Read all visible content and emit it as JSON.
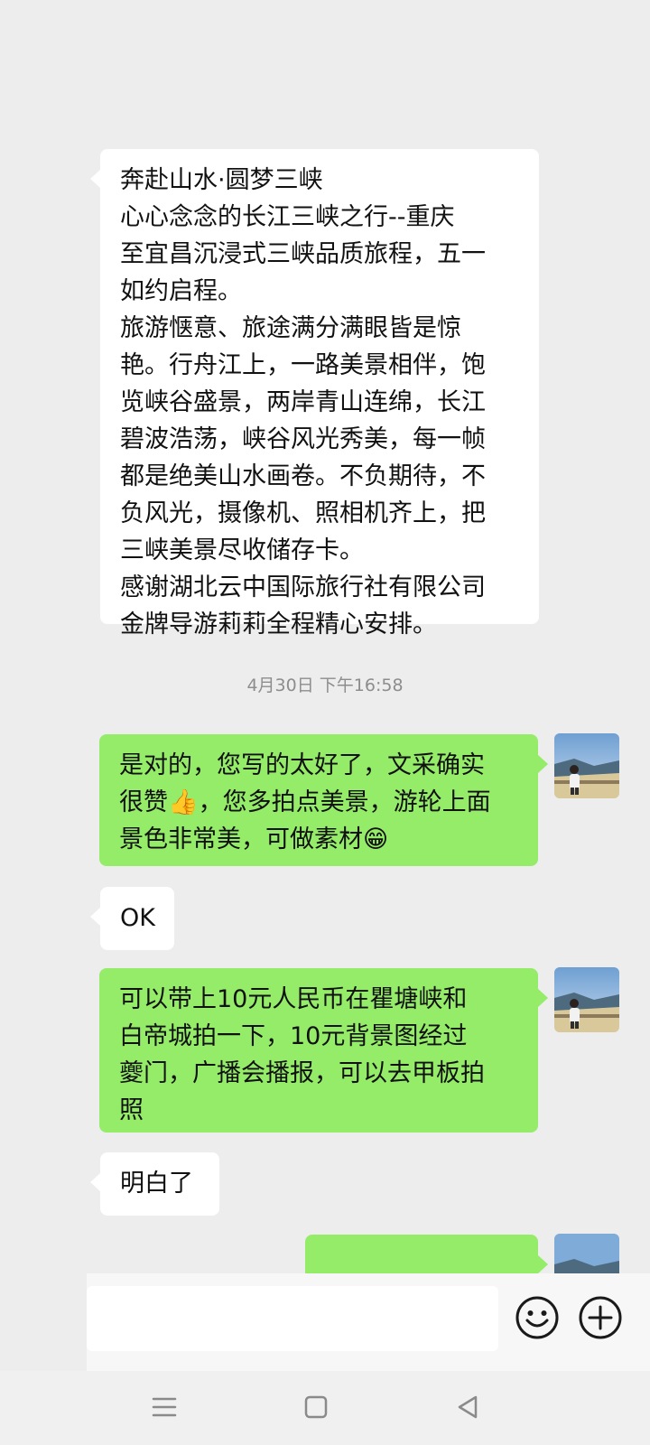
{
  "messages": [
    {
      "side": "in",
      "text": "奔赴山水·圆梦三峡\n心心念念的长江三峡之行--重庆\n至宜昌沉浸式三峡品质旅程，五一\n如约启程。\n旅游惬意、旅途满分满眼皆是惊\n艳。行舟江上，一路美景相伴，饱\n览峡谷盛景，两岸青山连绵，长江\n碧波浩荡，峡谷风光秀美，每一帧\n都是绝美山水画卷。不负期待，不\n负风光，摄像机、照相机齐上，把\n三峡美景尽收储存卡。\n感谢湖北云中国际旅行社有限公司\n金牌导游莉莉全程精心安排。"
    },
    {
      "side": "out",
      "text": "是对的，您写的太好了，文采确实\n很赞👍，您多拍点美景，游轮上面\n景色非常美，可做素材😁"
    },
    {
      "side": "in",
      "text": "OK"
    },
    {
      "side": "out",
      "text": "可以带上10元人民币在瞿塘峡和\n白帝城拍一下，10元背景图经过\n夔门，广播会播报，可以去甲板拍\n照"
    },
    {
      "side": "in",
      "text": "明白了"
    }
  ],
  "timestamp": "4月30日 下午16:58",
  "input": {
    "value": ""
  },
  "icons": {
    "emoji": "emoji-icon",
    "plus": "plus-icon",
    "menu": "menu-icon",
    "home": "home-icon",
    "back": "back-icon"
  },
  "colors": {
    "background": "#ededed",
    "incoming_bubble": "#ffffff",
    "outgoing_bubble": "#95ec69",
    "timestamp_text": "#8d8d8d"
  }
}
